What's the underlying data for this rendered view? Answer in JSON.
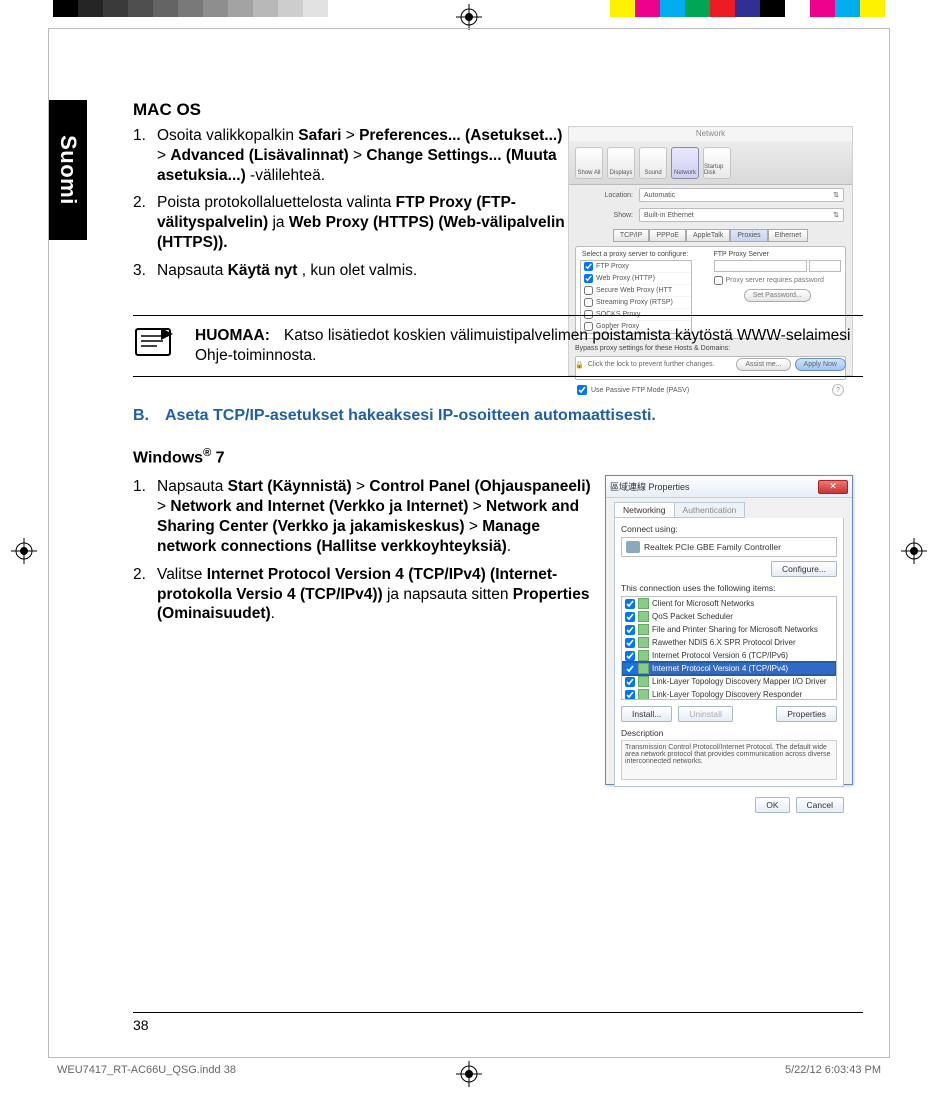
{
  "domain": "Document",
  "page_number": "38",
  "sidetab": "Suomi",
  "footer": {
    "file": "WEU7417_RT-AC66U_QSG.indd   38",
    "date": "5/22/12   6:03:43 PM"
  },
  "colorbars": {
    "left": [
      "#000000",
      "#252525",
      "#3a3a3a",
      "#4f4f4f",
      "#646464",
      "#797979",
      "#8e8e8e",
      "#a3a3a3",
      "#b8b8b8",
      "#cdcdcd",
      "#e2e2e2",
      "#ffffff"
    ],
    "right": [
      "#ffffff",
      "#fff200",
      "#ec008c",
      "#00aeef",
      "#00a651",
      "#ed1c24",
      "#2e3192",
      "#000000",
      "#ffffff",
      "#ec008c",
      "#00aeef",
      "#fff200"
    ]
  },
  "macos": {
    "heading": "MAC OS",
    "steps": [
      {
        "num": "1.",
        "parts": [
          "Osoita valikkopalkin ",
          {
            "b": "Safari"
          },
          " > ",
          {
            "b": "Preferences... (Asetukset...)"
          },
          " > ",
          {
            "b": "Advanced (Lisävalinnat)"
          },
          " > ",
          {
            "b": "Change  Settings... (Muuta asetuksia...)"
          },
          " -väli­lehteä."
        ]
      },
      {
        "num": "2.",
        "parts": [
          "Poista protokollaluettelosta valinta ",
          {
            "b": "FTP Proxy (FTP-välityspalvelin)"
          },
          " ja ",
          {
            "b": "Web Proxy (HTTPS) (Web-välipalvelin (HTTPS))."
          }
        ]
      },
      {
        "num": "3.",
        "parts": [
          "Napsauta ",
          {
            "b": "Käytä nyt"
          },
          " , kun olet valmis."
        ]
      }
    ],
    "shot": {
      "title": "Network",
      "toolbar": [
        "Show All",
        "Displays",
        "Sound",
        "Network",
        "Startup Disk"
      ],
      "toolbar_selected": 3,
      "location_label": "Location:",
      "location_value": "Automatic",
      "show_label": "Show:",
      "show_value": "Built-in Ethernet",
      "tabs": [
        "TCP/IP",
        "PPPoE",
        "AppleTalk",
        "Proxies",
        "Ethernet"
      ],
      "tabs_selected": 3,
      "proxy_label": "Select a proxy server to configure:",
      "proxy_server_label": "FTP Proxy Server",
      "proxy_list": [
        {
          "label": "FTP Proxy",
          "checked": true
        },
        {
          "label": "Web Proxy (HTTP)",
          "checked": true
        },
        {
          "label": "Secure Web Proxy (HTT",
          "checked": false
        },
        {
          "label": "Streaming Proxy (RTSP)",
          "checked": false
        },
        {
          "label": "SOCKS Proxy",
          "checked": false
        },
        {
          "label": "Gopher Proxy",
          "checked": false
        }
      ],
      "proxy_pw_note": "Proxy server requires password",
      "set_pw_btn": "Set Password...",
      "bypass_label": "Bypass proxy settings for these Hosts & Domains:",
      "passive_label": "Use Passive FTP Mode (PASV)",
      "help_glyph": "?",
      "lock_text": "Click the lock to prevent further changes.",
      "assist_btn": "Assist me...",
      "apply_btn": "Apply Now"
    }
  },
  "note": {
    "lead": "HUOMAA:",
    "body": "Katso lisätiedot koskien välimuistipalvelimen poistamista käytöstä WWW-selaimesi Ohje-toiminnosta."
  },
  "section_b": {
    "letter": "B.",
    "title": "Aseta TCP/IP-asetukset hakeaksesi IP-osoitteen automaattisesti."
  },
  "win7": {
    "heading": "Windows",
    "reg": "®",
    "heading_suffix": " 7",
    "steps": [
      {
        "num": "1.",
        "parts": [
          "Napsauta ",
          {
            "b": "Start (Käynnistä)"
          },
          " > ",
          {
            "b": "Control Panel (Ohjauspaneeli)"
          },
          " > ",
          {
            "b": "Network and Internet (Verk­ko ja Internet)"
          },
          " > ",
          {
            "b": "Network and Sharing Center (Verkko ja"
          },
          " ",
          {
            "b": "jakamiskeskus)"
          },
          " > ",
          {
            "b": "Manage network connec­tions (Hallitse verkkoyhteyksiä)"
          },
          "."
        ]
      },
      {
        "num": "2.",
        "parts": [
          "Valitse ",
          {
            "b": "Internet Protocol Version 4 (TCP/IPv4) (Internet-protokolla Versio 4 (TCP/IPv4))"
          },
          " ja napsauta sitten ",
          {
            "b": "Properties (Ominaisuudet)"
          },
          "."
        ]
      }
    ],
    "shot": {
      "title": "區域連線 Properties",
      "tabs": [
        "Networking",
        "Authentication"
      ],
      "connect_label": "Connect using:",
      "adapter": "Realtek PCIe GBE Family Controller",
      "configure_btn": "Configure...",
      "uses_label": "This connection uses the following items:",
      "items": [
        "Client for Microsoft Networks",
        "QoS Packet Scheduler",
        "File and Printer Sharing for Microsoft Networks",
        "Rawether NDIS 6.X SPR Protocol Driver",
        "Internet Protocol Version 6 (TCP/IPv6)",
        "Internet Protocol Version 4 (TCP/IPv4)",
        "Link-Layer Topology Discovery Mapper I/O Driver",
        "Link-Layer Topology Discovery Responder"
      ],
      "selected_index": 5,
      "install_btn": "Install...",
      "uninstall_btn": "Uninstall",
      "properties_btn": "Properties",
      "desc_label": "Description",
      "desc_text": "Transmission Control Protocol/Internet Protocol. The default wide area network protocol that provides communication across diverse interconnected networks.",
      "ok_btn": "OK",
      "cancel_btn": "Cancel"
    }
  }
}
